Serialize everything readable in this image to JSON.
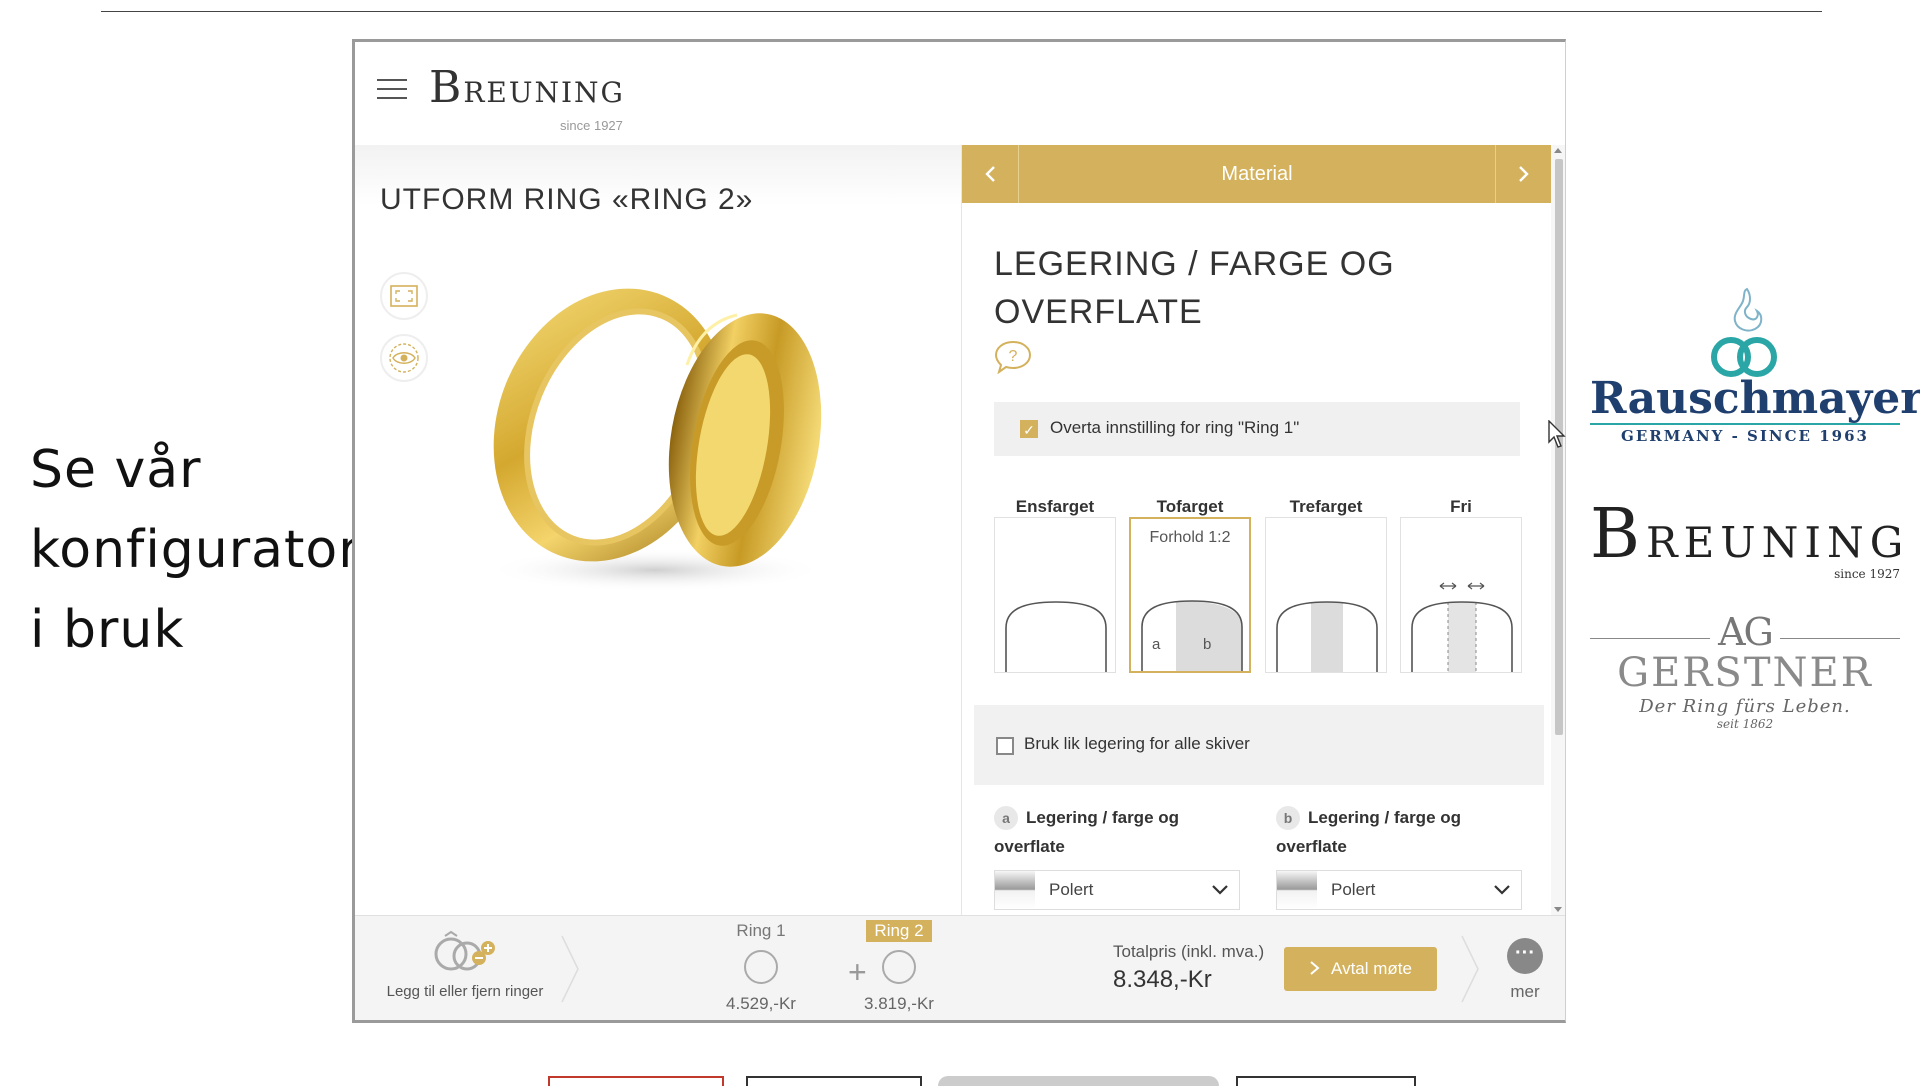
{
  "caption": {
    "lines": [
      "Se vår",
      "konfigurator",
      "i bruk"
    ]
  },
  "brands": {
    "rauschmayer": {
      "name": "Rauschmayer",
      "sub": "GERMANY - SINCE 1963"
    },
    "breuning": {
      "first": "B",
      "rest": "REUNING",
      "since": "since 1927"
    },
    "gerstner": {
      "ag": "AG",
      "name": "GERSTNER",
      "tagline": "Der Ring fürs Leben.",
      "seit": "seit 1862"
    }
  },
  "site": {
    "logo": {
      "first": "B",
      "rest": "REUNING",
      "since": "since 1927"
    }
  },
  "left_pane": {
    "title": "UTFORM RING «RING 2»"
  },
  "right_pane": {
    "nav_title": "Material",
    "heading": "LEGERING / FARGE OG OVERFLATE",
    "takeover_label": "Overta innstilling for ring \"Ring 1\"",
    "takeover_checked": true,
    "options": [
      {
        "label": "Ensfarget"
      },
      {
        "label": "Tofarget",
        "ratio": "Forhold 1:2",
        "a": "a",
        "b": "b",
        "selected": true
      },
      {
        "label": "Trefarget"
      },
      {
        "label": "Fri"
      }
    ],
    "same_alloy_label": "Bruk lik legering for alle skiver",
    "same_alloy_checked": false,
    "alloys": [
      {
        "badge": "a",
        "head_bold": "Legering / farge og",
        "head_rest": "overflate",
        "value": "Polert"
      },
      {
        "badge": "b",
        "head_bold": "Legering / farge og",
        "head_rest": "overflate",
        "value": "Polert"
      }
    ]
  },
  "footer": {
    "add_label": "Legg til eller fjern ringer",
    "ring1": {
      "label": "Ring 1",
      "price": "4.529,-Kr"
    },
    "ring2": {
      "label": "Ring 2",
      "price": "3.819,-Kr"
    },
    "plus": "+",
    "total_label": "Totalpris (inkl. mva.)",
    "total_value": "8.348,-Kr",
    "cta": "Avtal møte",
    "more_label": "mer"
  },
  "colors": {
    "gold": "#d4b15c",
    "rauschmayer_blue": "#1f3f6e",
    "rauschmayer_teal": "#2aa6a6"
  },
  "icons": [
    "hamburger-icon",
    "fullscreen-icon",
    "view-360-icon",
    "help-icon",
    "chevron-left-icon",
    "chevron-right-icon",
    "chevron-down-icon",
    "add-remove-rings-icon",
    "more-icon",
    "cursor-icon"
  ]
}
